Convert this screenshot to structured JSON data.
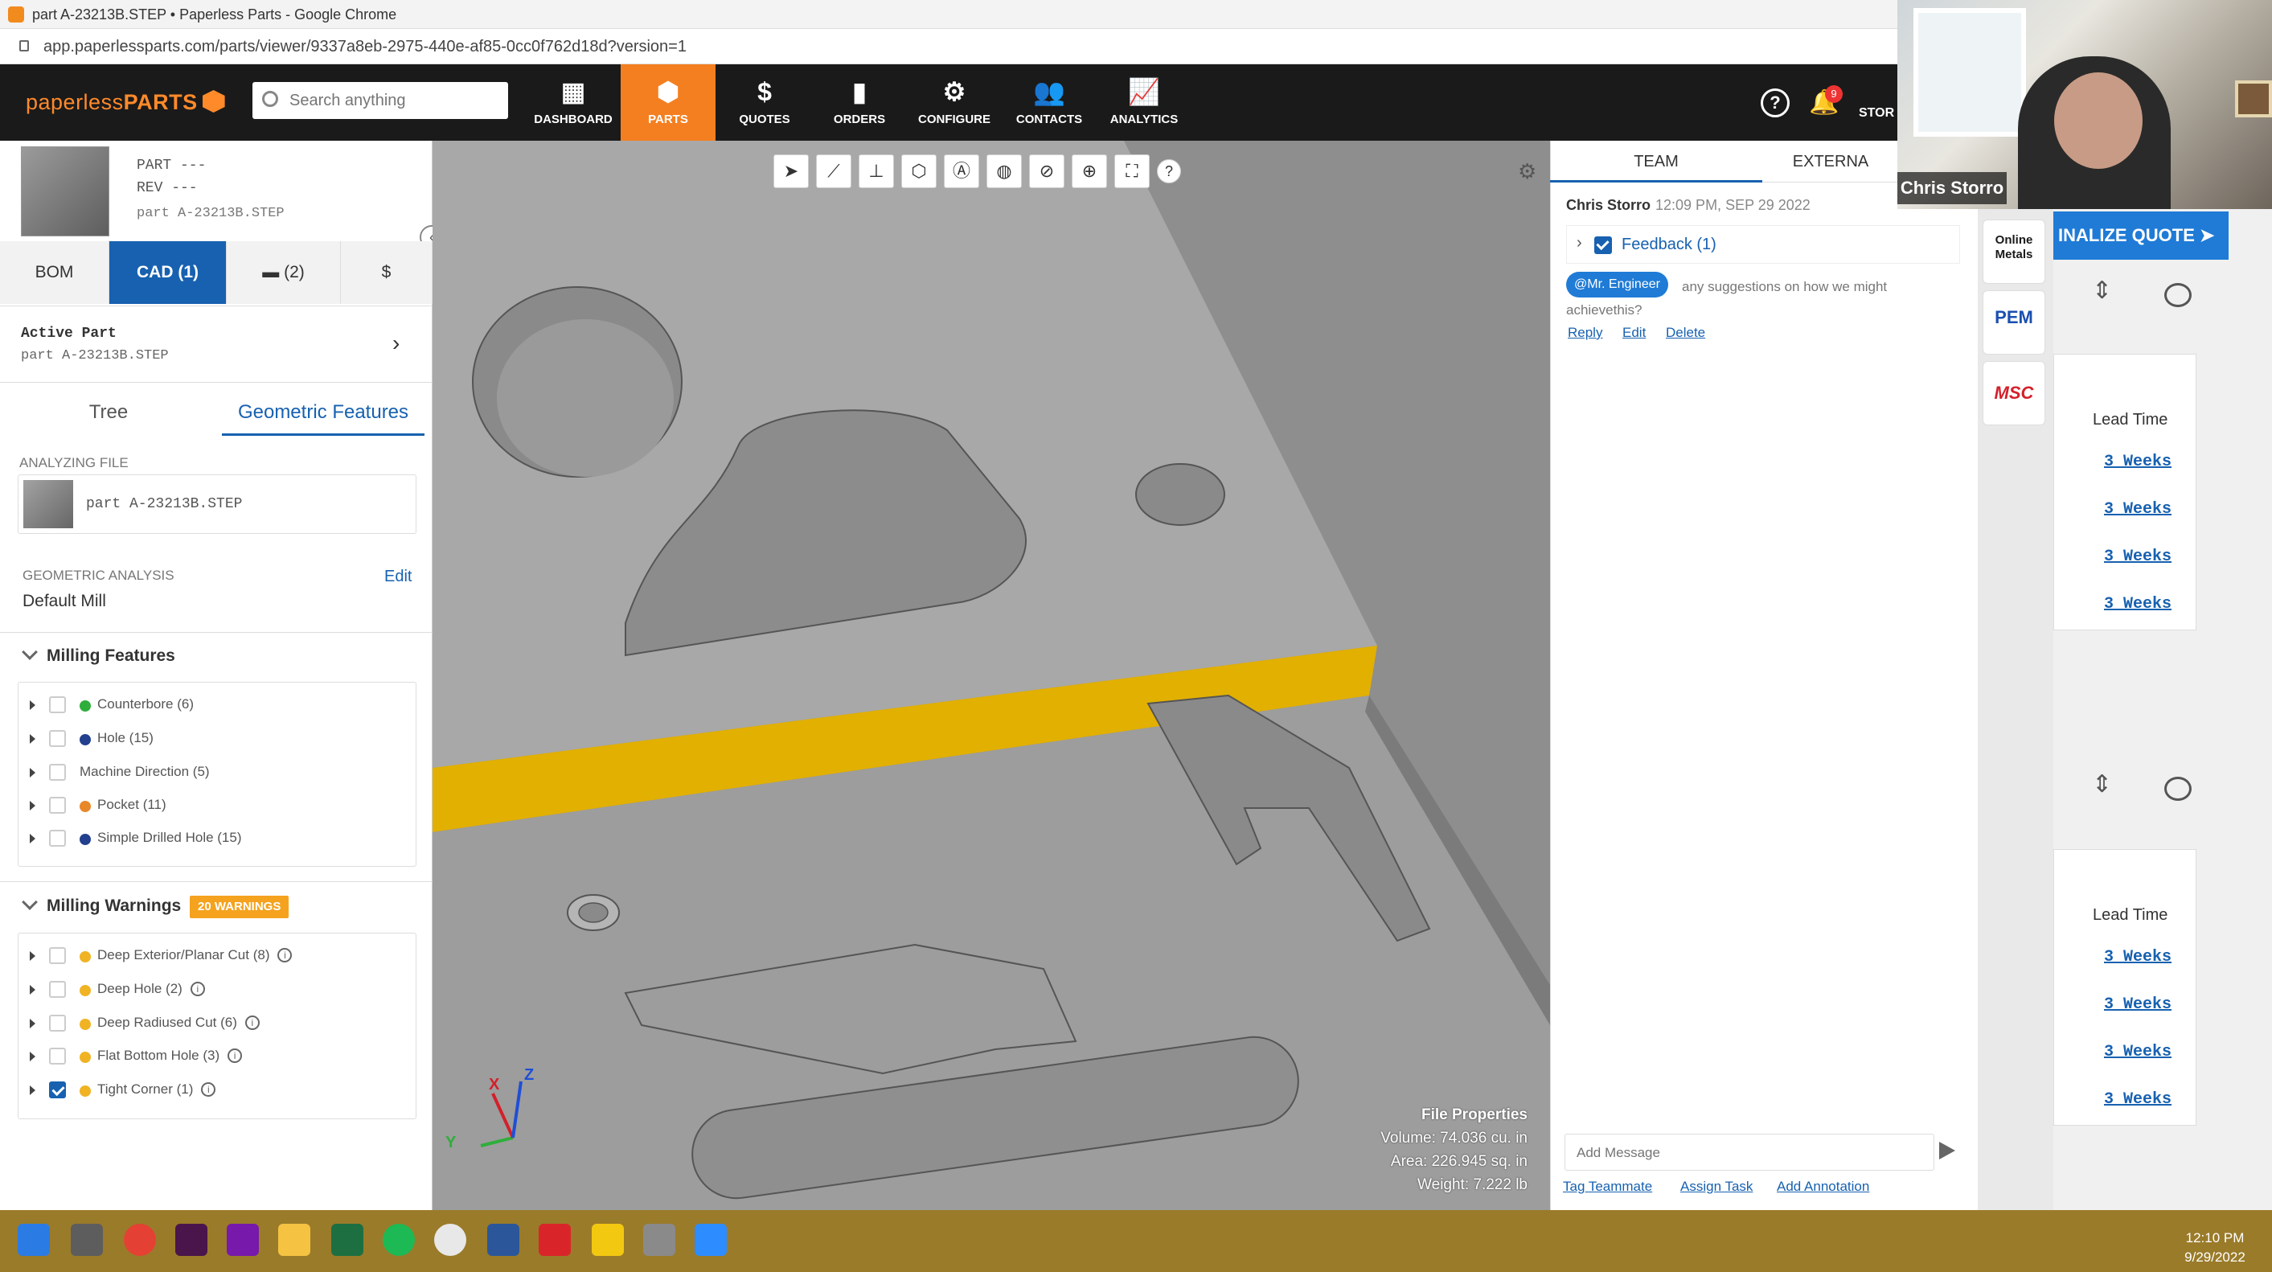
{
  "browser": {
    "window_title": "part A-23213B.STEP • Paperless Parts - Google Chrome",
    "url": "app.paperlessparts.com/parts/viewer/9337a8eb-2975-440e-af85-0cc0f762d18d?version=1"
  },
  "nav": {
    "logo_plain": "paperless",
    "logo_bold": "PARTS",
    "search_placeholder": "Search anything",
    "items": [
      {
        "label": "DASHBOARD",
        "icon": "grid-icon",
        "glyph": "▦"
      },
      {
        "label": "PARTS",
        "icon": "cube-icon",
        "glyph": "⬢",
        "active": true
      },
      {
        "label": "QUOTES",
        "icon": "dollar-icon",
        "glyph": "$"
      },
      {
        "label": "ORDERS",
        "icon": "clipboard-icon",
        "glyph": "▮"
      },
      {
        "label": "CONFIGURE",
        "icon": "gears-icon",
        "glyph": "⚙"
      },
      {
        "label": "CONTACTS",
        "icon": "people-icon",
        "glyph": "👥"
      },
      {
        "label": "ANALYTICS",
        "icon": "chart-icon",
        "glyph": "📈"
      }
    ],
    "notification_count": "9",
    "store_label": "STOR"
  },
  "webcam": {
    "name": "Chris Storro"
  },
  "part": {
    "part_label": "PART ---",
    "rev_label": "REV ---",
    "filename": "part A-23213B.STEP"
  },
  "left_tabs": [
    "BOM",
    "CAD (1)",
    "(2)",
    "$"
  ],
  "active_part": {
    "title": "Active Part",
    "filename": "part A-23213B.STEP"
  },
  "subtabs": [
    "Tree",
    "Geometric Features"
  ],
  "analyzing": {
    "label": "ANALYZING FILE",
    "filename": "part A-23213B.STEP"
  },
  "analysis": {
    "label": "GEOMETRIC ANALYSIS",
    "value": "Default Mill",
    "edit": "Edit"
  },
  "milling_features": {
    "title": "Milling Features",
    "items": [
      {
        "label": "Counterbore (6)",
        "color": "#2fae3b",
        "checked": false
      },
      {
        "label": "Hole (15)",
        "color": "#23408e",
        "checked": false
      },
      {
        "label": "Machine Direction (5)",
        "color": "",
        "checked": false
      },
      {
        "label": "Pocket (11)",
        "color": "#e8872a",
        "checked": false
      },
      {
        "label": "Simple Drilled Hole (15)",
        "color": "#23408e",
        "checked": false
      }
    ]
  },
  "milling_warnings": {
    "title": "Milling Warnings",
    "badge": "20 WARNINGS",
    "items": [
      {
        "label": "Deep Exterior/Planar Cut (8)",
        "color": "#f0b323",
        "checked": false
      },
      {
        "label": "Deep Hole (2)",
        "color": "#f0b323",
        "checked": false
      },
      {
        "label": "Deep Radiused Cut (6)",
        "color": "#f0b323",
        "checked": false
      },
      {
        "label": "Flat Bottom Hole (3)",
        "color": "#f0b323",
        "checked": false
      },
      {
        "label": "Tight Corner (1)",
        "color": "#f0b323",
        "checked": true
      }
    ]
  },
  "viewer": {
    "tools": [
      "pointer-icon",
      "measure-icon",
      "section-icon",
      "cube-view-icon",
      "annotate-icon",
      "globe-icon",
      "hide-icon",
      "target-icon",
      "fit-icon",
      "help-icon"
    ],
    "tool_glyphs": [
      "➤",
      "⟋",
      "⊥",
      "⬡",
      "Ⓐ",
      "◍",
      "⊘",
      "⊕",
      "⛶",
      "?"
    ],
    "file_properties": {
      "title": "File Properties",
      "volume": "Volume: 74.036 cu. in",
      "area": "Area: 226.945 sq. in",
      "weight": "Weight: 7.222 lb"
    },
    "axes": {
      "x": "X",
      "y": "Y",
      "z": "Z"
    }
  },
  "comments": {
    "tabs": [
      "TEAM",
      "EXTERNA"
    ],
    "author": "Chris Storro",
    "timestamp": "12:09 PM, SEP 29 2022",
    "feedback_label": "Feedback (1)",
    "mention": "@Mr. Engineer",
    "text": "any suggestions on how we might achievethis?",
    "actions": [
      "Reply",
      "Edit",
      "Delete"
    ],
    "message_placeholder": "Add Message",
    "footer_links": [
      "Tag Teammate",
      "Assign Task",
      "Add Annotation"
    ]
  },
  "vendors": [
    {
      "name": "Online Metals",
      "color": "#1a1a1a"
    },
    {
      "name": "PEM",
      "color": "#1a4fb0"
    },
    {
      "name": "MSC",
      "color": "#d3202a"
    }
  ],
  "background_page": {
    "finalize": "INALIZE QUOTE ➤",
    "lead_time_header": "Lead Time",
    "group1": [
      "3 Weeks",
      "3 Weeks",
      "3 Weeks",
      "3 Weeks"
    ],
    "group2": [
      "3 Weeks",
      "3 Weeks",
      "3 Weeks",
      "3 Weeks"
    ]
  },
  "taskbar": {
    "apps": [
      "windows-start-icon",
      "task-view-icon",
      "chrome-icon",
      "slack-icon",
      "onenote-icon",
      "file-explorer-icon",
      "excel-icon",
      "spotify-icon",
      "itunes-icon",
      "word-icon",
      "acrobat-icon",
      "app-icon",
      "snipping-icon",
      "zoom-icon"
    ],
    "app_colors": [
      "#2b7be4",
      "#5d5d5d",
      "#e44134",
      "#4a154b",
      "#7719aa",
      "#f5c242",
      "#1d6f42",
      "#1db954",
      "#e8e8e8",
      "#2b579a",
      "#d9252a",
      "#f2c811",
      "#8a8a8a",
      "#2d8cff"
    ],
    "time": "12:10 PM",
    "date": "9/29/2022"
  }
}
